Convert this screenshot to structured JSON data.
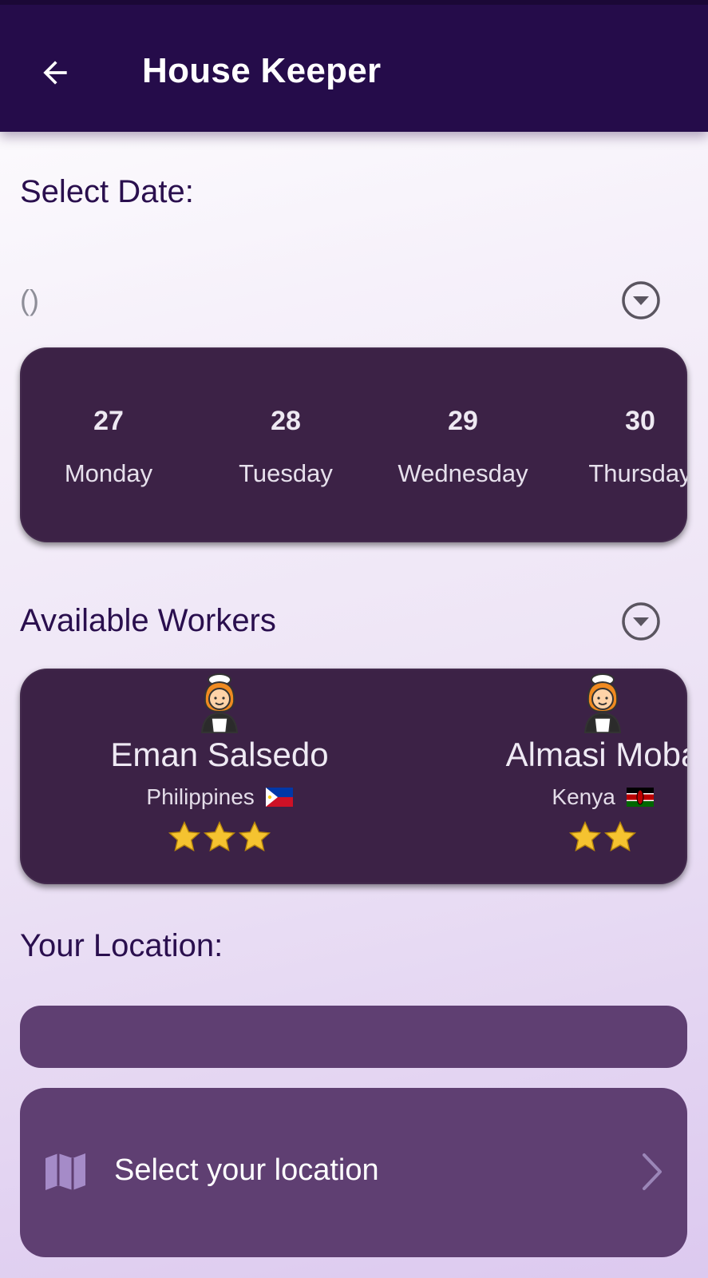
{
  "appbar": {
    "title": "House Keeper"
  },
  "date_section": {
    "label": "Select Date:",
    "value": "()",
    "dates": [
      {
        "num": "27",
        "day": "Monday"
      },
      {
        "num": "28",
        "day": "Tuesday"
      },
      {
        "num": "29",
        "day": "Wednesday"
      },
      {
        "num": "30",
        "day": "Thursday"
      }
    ]
  },
  "workers_section": {
    "label": "Available Workers",
    "workers": [
      {
        "name": "Eman Salsedo",
        "country": "Philippines",
        "stars": 3
      },
      {
        "name": "Almasi Moba",
        "country": "Kenya",
        "stars": 2
      }
    ]
  },
  "location_section": {
    "label": "Your Location:",
    "input_value": "",
    "select_label": "Select your location"
  },
  "colors": {
    "appbar": "#250c4a",
    "card": "#3c2246",
    "location_field": "#5f3f72",
    "label_text": "#2a0f4e"
  },
  "icons": [
    "arrow-back-icon",
    "dropdown-circle-icon",
    "maid-icon",
    "philippines-flag-icon",
    "kenya-flag-icon",
    "star-icon",
    "map-icon",
    "chevron-right-icon"
  ]
}
